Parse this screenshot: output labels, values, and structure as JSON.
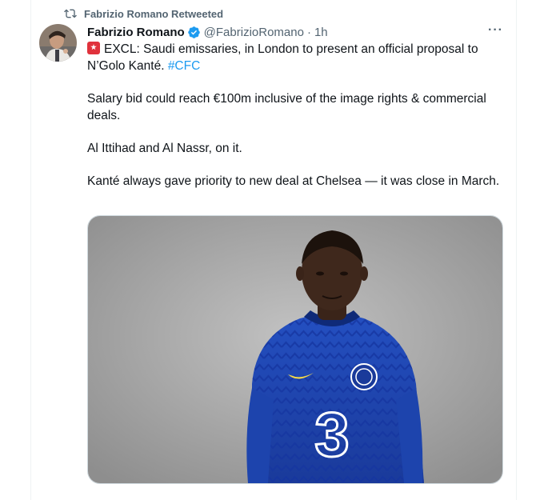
{
  "retweet": {
    "label": "Fabrizio Romano Retweeted",
    "icon": "retweet-icon"
  },
  "author": {
    "name": "Fabrizio Romano",
    "handle": "@FabrizioRomano",
    "separator": "·",
    "time": "1h",
    "verified": true
  },
  "more_label": "···",
  "tweet": {
    "line1_text": "EXCL: Saudi emissaries, in London to present an official proposal to N’Golo Kanté.",
    "hashtag": "#CFC",
    "paragraph2": "Salary bid could reach €100m inclusive of the image rights & commercial deals.",
    "paragraph3": "Al Ittihad and Al Nassr, on it.",
    "paragraph4": "Kanté always gave priority to new deal at Chelsea — it was close in March."
  },
  "media": {
    "description_icon": "photo-player-in-chelsea-kit"
  },
  "colors": {
    "accent": "#1d9bf0",
    "secondary_text": "#536471",
    "kit_blue": "#1a3fa0"
  }
}
